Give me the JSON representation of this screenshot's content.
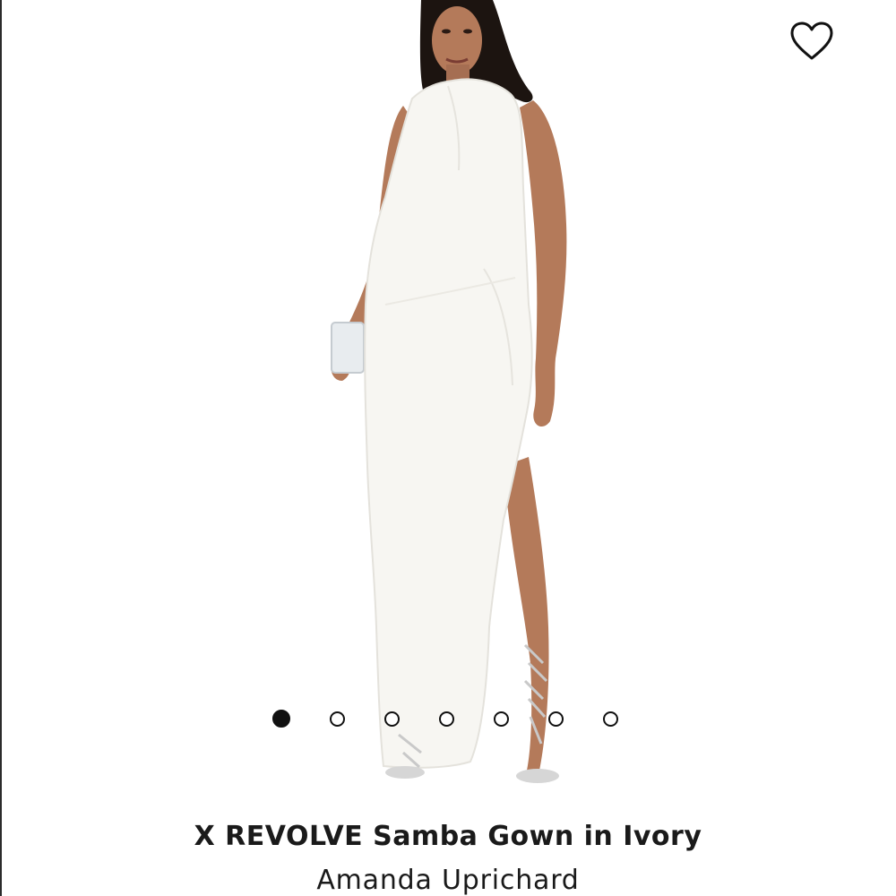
{
  "product": {
    "title": "X REVOLVE Samba Gown in Ivory",
    "brand": "Amanda Uprichard"
  },
  "favorite": {
    "icon": "heart-outline-icon"
  },
  "carousel": {
    "total": 7,
    "active_index": 0
  },
  "colors": {
    "text": "#1a1a1a",
    "dress": "#f7f6f2",
    "skin": "#b47a5a",
    "hair": "#1c1410"
  }
}
